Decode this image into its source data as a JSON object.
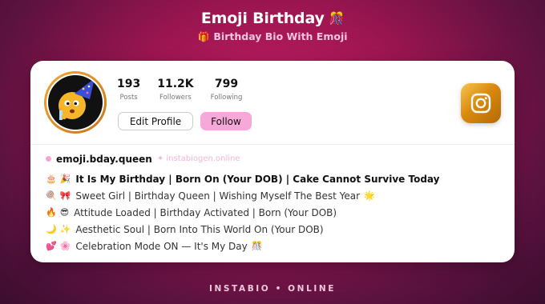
{
  "header": {
    "title": "Emoji Birthday",
    "title_emoji": "🎊",
    "subtitle_emoji": "🎁",
    "subtitle": "Birthday Bio With Emoji"
  },
  "profile": {
    "stats": [
      {
        "value": "193",
        "label": "Posts"
      },
      {
        "value": "11.2K",
        "label": "Followers"
      },
      {
        "value": "799",
        "label": "Following"
      }
    ],
    "edit_label": "Edit Profile",
    "follow_label": "Follow",
    "username": "emoji.bday.queen",
    "watermark": "✦ instabiogen.online"
  },
  "bio": [
    {
      "e1": "🎂",
      "e2": "🎉",
      "text": "It Is My Birthday | Born On (Your DOB) | Cake Cannot Survive Today",
      "trail": ""
    },
    {
      "e1": "🍭",
      "e2": "🎀",
      "text": "Sweet Girl | Birthday Queen | Wishing Myself The Best Year",
      "trail": "🌟"
    },
    {
      "e1": "🔥",
      "e2": "😎",
      "text": "Attitude Loaded | Birthday Activated | Born (Your DOB)",
      "trail": ""
    },
    {
      "e1": "🌙",
      "e2": "✨",
      "text": "Aesthetic Soul | Born Into This World On (Your DOB)",
      "trail": ""
    },
    {
      "e1": "💕",
      "e2": "🌸",
      "text": "Celebration Mode ON — It's My Day",
      "trail": "🎊"
    }
  ],
  "footer": "INSTABIO • ONLINE",
  "colors": {
    "background": "#9a1550",
    "follow_button": "#f6a9d9",
    "instagram_gradient": "#d98a0e"
  },
  "icons": [
    "party-emoji-avatar",
    "instagram-icon"
  ]
}
